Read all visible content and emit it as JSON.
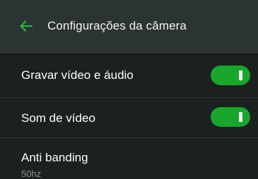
{
  "header": {
    "title": "Configurações da câmera",
    "back_icon": "arrow-left-icon",
    "accent": "#27c23a"
  },
  "settings": [
    {
      "label": "Gravar vídeo e áudio",
      "toggle_on": true
    },
    {
      "label": "Som de vídeo",
      "toggle_on": true
    },
    {
      "label": "Anti banding",
      "value": "50hz"
    }
  ],
  "colors": {
    "background": "#1b2020",
    "header": "#2c3433",
    "toggle_on": "#18a62c",
    "secondary_text": "#8a9190"
  }
}
